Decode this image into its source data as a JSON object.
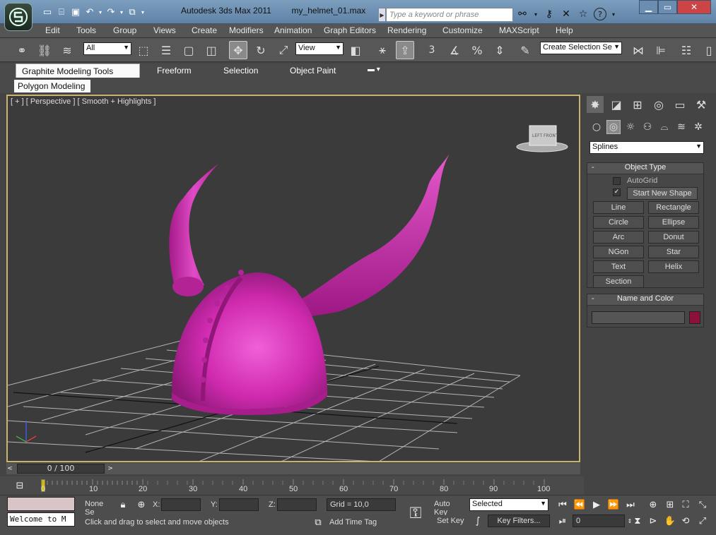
{
  "title": {
    "app": "Autodesk 3ds Max  2011",
    "file": "my_helmet_01.max",
    "search_placeholder": "Type a keyword or phrase"
  },
  "menu": [
    "Edit",
    "Tools",
    "Group",
    "Views",
    "Create",
    "Modifiers",
    "Animation",
    "Graph Editors",
    "Rendering",
    "Customize",
    "MAXScript",
    "Help"
  ],
  "toolbar": {
    "selection_filter": "All",
    "ref_coord": "View",
    "named_selection": "Create Selection Se",
    "snap_label": "3"
  },
  "ribbon": {
    "tabs": [
      "Graphite Modeling Tools",
      "Freeform",
      "Selection",
      "Object Paint"
    ],
    "panel": "Polygon Modeling"
  },
  "viewport": {
    "label": "[ + ] [ Perspective ] [ Smooth + Highlights ]",
    "viewcube_left": "LEFT",
    "viewcube_front": "FRONT"
  },
  "command_panel": {
    "category": "Splines",
    "object_type": {
      "title": "Object Type",
      "autogrid": "AutoGrid",
      "start_new_shape": "Start New Shape",
      "start_new_shape_checked": true,
      "buttons": [
        "Line",
        "Rectangle",
        "Circle",
        "Ellipse",
        "Arc",
        "Donut",
        "NGon",
        "Star",
        "Text",
        "Helix",
        "Section"
      ]
    },
    "name_color": {
      "title": "Name and Color",
      "name_value": "",
      "color": "#8c1038"
    }
  },
  "timeline": {
    "position": "0 / 100",
    "ticks": [
      "0",
      "10",
      "20",
      "30",
      "40",
      "50",
      "60",
      "70",
      "80",
      "90",
      "100"
    ]
  },
  "status": {
    "script_listener": "Welcome to M",
    "selection_state": "None Se",
    "x_label": "X:",
    "y_label": "Y:",
    "z_label": "Z:",
    "x_value": "",
    "y_value": "",
    "z_value": "",
    "grid": "Grid = 10,0",
    "auto_key": "Auto Key",
    "set_key": "Set Key",
    "key_mode": "Selected",
    "key_filters": "Key Filters...",
    "frame": "0",
    "prompt": "Click and drag to select and move objects",
    "add_time_tag": "Add Time Tag"
  },
  "colors": {
    "helmet": "#d42fb3",
    "viewport_bg": "#3b3b3b",
    "active_border": "#c8b46a",
    "grid_line": "#b8b8b8"
  }
}
